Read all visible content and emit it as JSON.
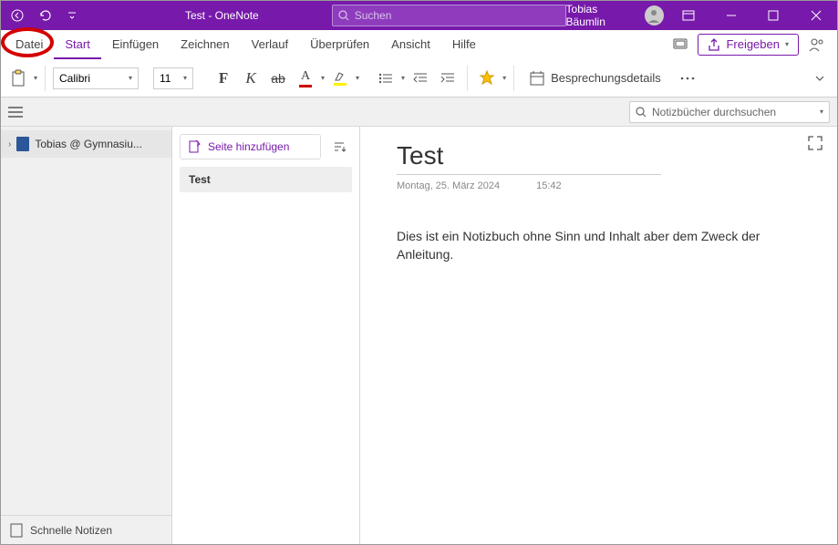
{
  "titlebar": {
    "title": "Test  -  OneNote",
    "search_placeholder": "Suchen",
    "user_name": "Tobias Bäumlin"
  },
  "ribbon": {
    "tabs": [
      "Datei",
      "Start",
      "Einfügen",
      "Zeichnen",
      "Verlauf",
      "Überprüfen",
      "Ansicht",
      "Hilfe"
    ],
    "active_tab": "Start",
    "share_label": "Freigeben",
    "font_name": "Calibri",
    "font_size": "11",
    "meeting_details": "Besprechungsdetails"
  },
  "subbar": {
    "search_placeholder": "Notizbücher durchsuchen"
  },
  "sidebar": {
    "notebook_name": "Tobias @ Gymnasiu...",
    "quick_notes": "Schnelle Notizen"
  },
  "pages": {
    "add_page": "Seite hinzufügen",
    "items": [
      "Test"
    ]
  },
  "note": {
    "title": "Test",
    "date": "Montag, 25. März 2024",
    "time": "15:42",
    "body": "Dies ist ein Notizbuch ohne Sinn und Inhalt aber dem Zweck der Anleitung."
  },
  "colors": {
    "accent": "#7719AA"
  }
}
